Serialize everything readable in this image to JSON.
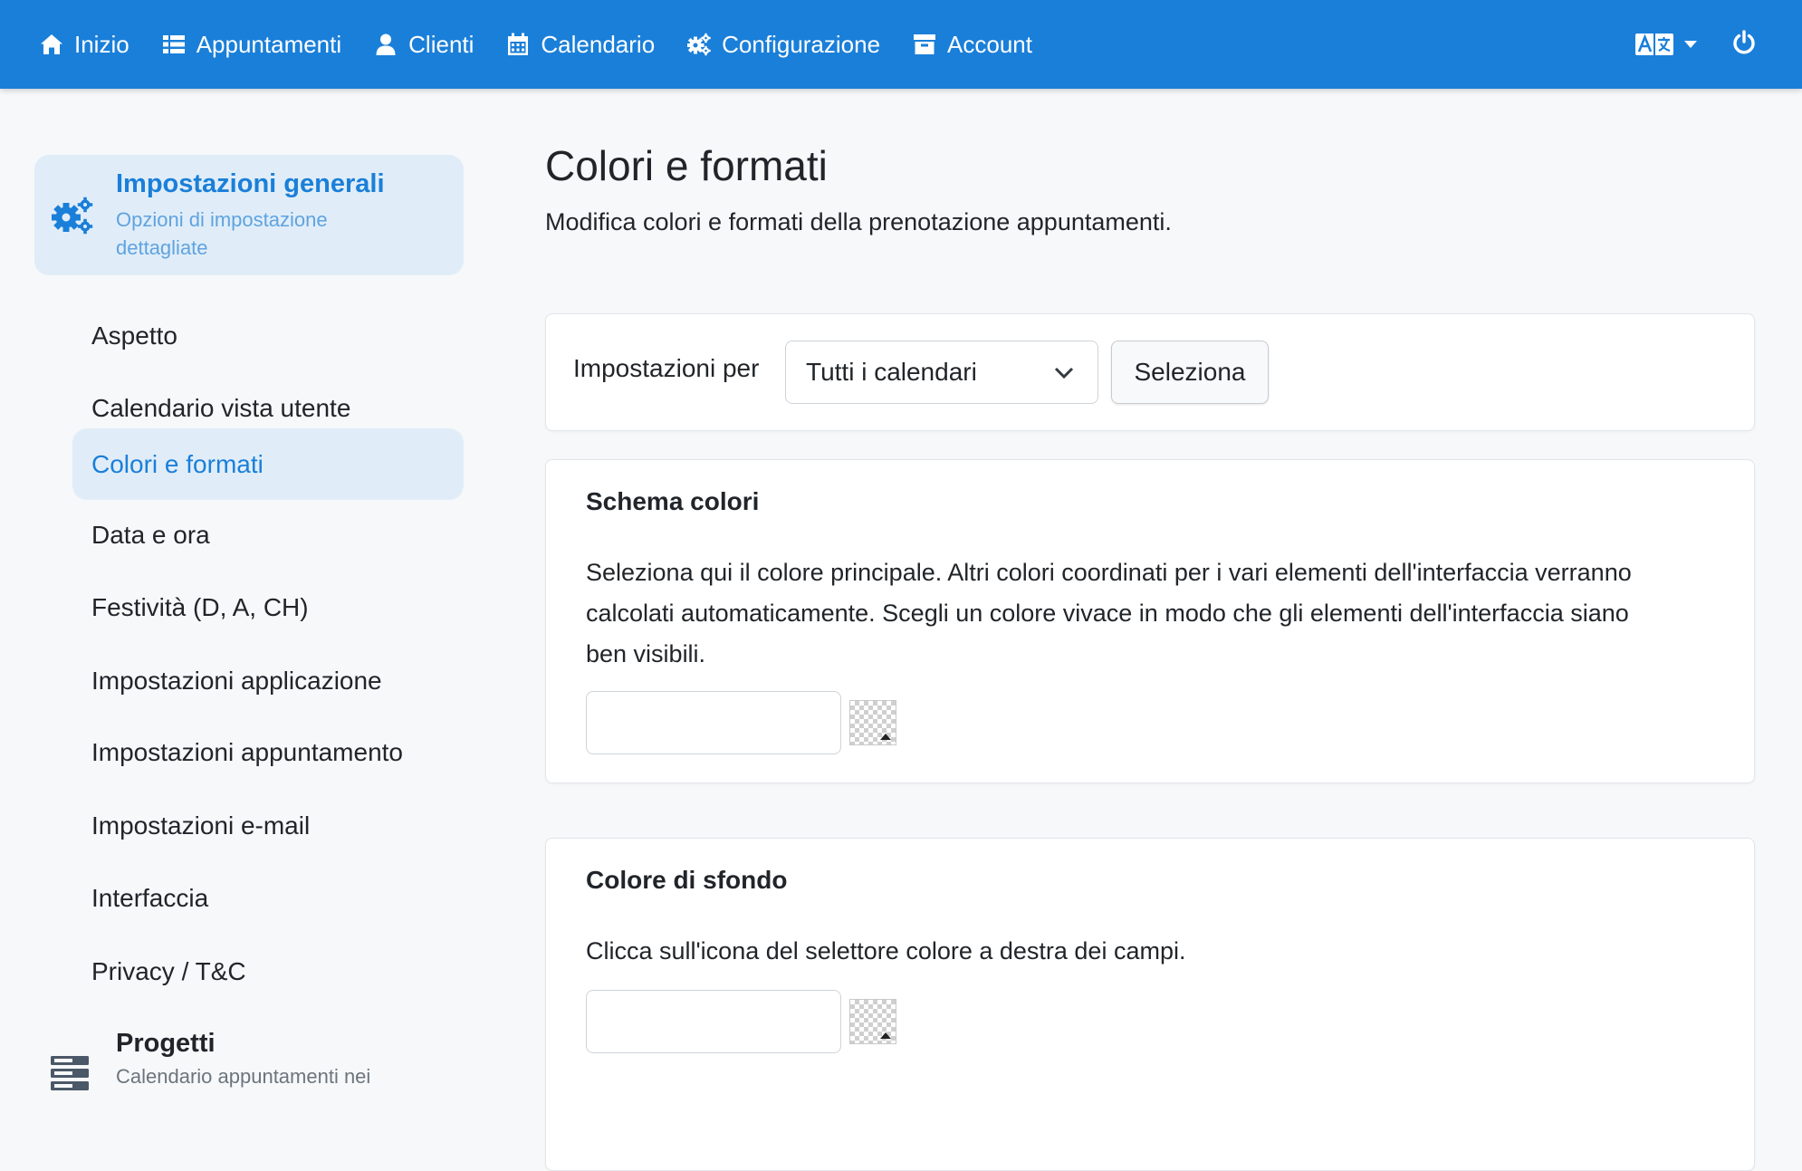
{
  "nav": {
    "items": [
      {
        "label": "Inizio",
        "icon": "home-icon"
      },
      {
        "label": "Appuntamenti",
        "icon": "list-icon"
      },
      {
        "label": "Clienti",
        "icon": "user-icon"
      },
      {
        "label": "Calendario",
        "icon": "calendar-icon"
      },
      {
        "label": "Configurazione",
        "icon": "gears-icon"
      },
      {
        "label": "Account",
        "icon": "archive-icon"
      }
    ],
    "language_icon": "translate-icon",
    "power_icon": "power-icon"
  },
  "sidebar": {
    "group": {
      "title": "Impostazioni generali",
      "subtitle": "Opzioni di impostazione dettagliate",
      "icon": "gears-icon"
    },
    "items": [
      {
        "label": "Aspetto"
      },
      {
        "label": "Calendario vista utente"
      },
      {
        "label": "Colori e formati",
        "active": true
      },
      {
        "label": "Data e ora"
      },
      {
        "label": "Festività (D, A, CH)"
      },
      {
        "label": "Impostazioni applicazione"
      },
      {
        "label": "Impostazioni appuntamento"
      },
      {
        "label": "Impostazioni e-mail"
      },
      {
        "label": "Interfaccia"
      },
      {
        "label": "Privacy / T&C"
      }
    ],
    "group2": {
      "title": "Progetti",
      "subtitle": "Calendario appuntamenti nei",
      "icon": "server-icon"
    }
  },
  "main": {
    "title": "Colori e formati",
    "description": "Modifica colori e formati della prenotazione appuntamenti.",
    "filter": {
      "label": "Impostazioni per",
      "selected": "Tutti i calendari",
      "button": "Seleziona"
    },
    "scheme": {
      "title": "Schema colori",
      "description": "Seleziona qui il colore principale. Altri colori coordinati per i vari elementi dell'interfaccia verranno calcolati automaticamente. Scegli un colore vivace in modo che gli elementi dell'interfaccia siano ben visibili.",
      "value": ""
    },
    "background": {
      "title": "Colore di sfondo",
      "description": "Clicca sull'icona del selettore colore a destra dei campi.",
      "value": ""
    }
  },
  "colors": {
    "primary": "#1a7fd9",
    "active_bg": "#e0edf8",
    "page_bg": "#f7f8fa"
  }
}
